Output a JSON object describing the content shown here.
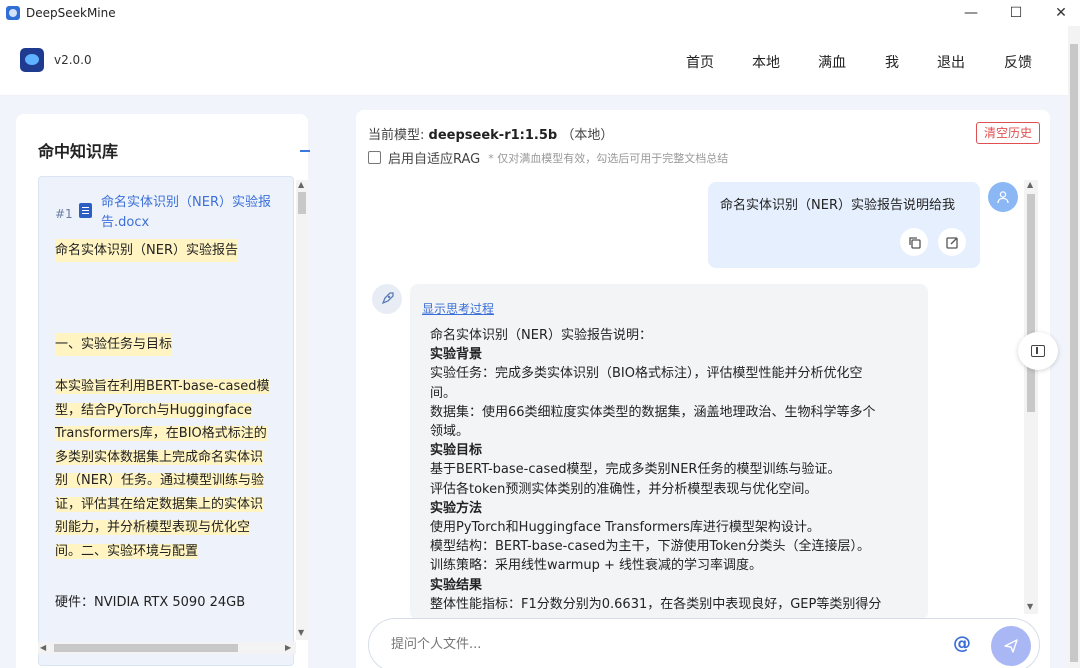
{
  "window": {
    "title": "DeepSeekMine",
    "min_glyph": "—",
    "max_glyph": "☐",
    "close_glyph": "✕"
  },
  "header": {
    "version": "v2.0.0",
    "nav": [
      "首页",
      "本地",
      "满血",
      "我",
      "退出",
      "反馈"
    ]
  },
  "knowledge": {
    "title": "命中知识库",
    "collapse_glyph": "—",
    "card": {
      "rank": "#1",
      "filename": "命名实体识别（NER）实验报告.docx",
      "subtitle": "命名实体识别（NER）实验报告",
      "section1": "一、实验任务与目标",
      "body_lines": [
        "本实验旨在利用BERT-base-cased模",
        "型，结合PyTorch与Huggingface",
        "Transformers库，在BIO格式标注的",
        "多类别实体数据集上完成命名实体识",
        "别（NER）任务。通过模型训练与验",
        "证，评估其在给定数据集上的实体识",
        "别能力，并分析模型表现与优化空",
        "间。二、实验环境与配置"
      ],
      "hardware": "硬件：NVIDIA RTX 5090 24GB"
    }
  },
  "chat": {
    "model_prefix": "当前模型:",
    "model_name": "deepseek-r1:1.5b",
    "model_suffix": "（本地）",
    "clear_label": "清空历史",
    "rag_label": "启用自适应RAG",
    "rag_note": "* 仅对满血模型有效，勾选后可用于完整文档总结",
    "user_message": "命名实体识别（NER）实验报告说明给我",
    "show_thinking": "显示思考过程",
    "answer_lines": [
      {
        "t": "命名实体识别（NER）实验报告说明：",
        "h": false
      },
      {
        "t": "实验背景",
        "h": true
      },
      {
        "t": "实验任务：完成多类实体识别（BIO格式标注），评估模型性能并分析优化空",
        "h": false
      },
      {
        "t": "间。",
        "h": false
      },
      {
        "t": "数据集：使用66类细粒度实体类型的数据集，涵盖地理政治、生物科学等多个",
        "h": false
      },
      {
        "t": "领域。",
        "h": false
      },
      {
        "t": "实验目标",
        "h": true
      },
      {
        "t": "基于BERT-base-cased模型，完成多类别NER任务的模型训练与验证。",
        "h": false
      },
      {
        "t": "评估各token预测实体类别的准确性，并分析模型表现与优化空间。",
        "h": false
      },
      {
        "t": "实验方法",
        "h": true
      },
      {
        "t": "使用PyTorch和Huggingface Transformers库进行模型架构设计。",
        "h": false
      },
      {
        "t": "模型结构：BERT-base-cased为主干，下游使用Token分类头（全连接层）。",
        "h": false
      },
      {
        "t": "训练策略：采用线性warmup + 线性衰减的学习率调度。",
        "h": false
      },
      {
        "t": "实验结果",
        "h": true
      },
      {
        "t": "整体性能指标：F1分数分别为0.6631，在各类别中表现良好，GEP等类别得分",
        "h": false
      }
    ],
    "input_placeholder": "提问个人文件...",
    "at_glyph": "@"
  }
}
